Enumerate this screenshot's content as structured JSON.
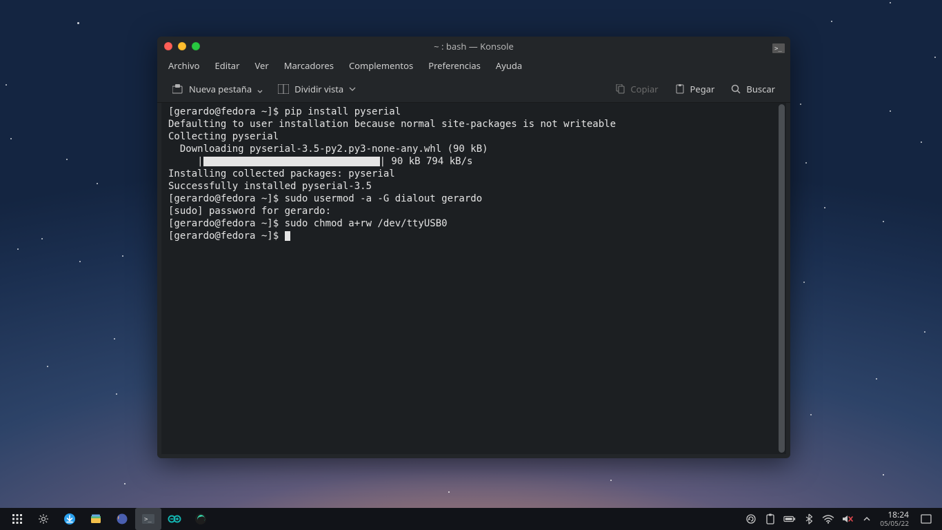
{
  "window": {
    "title": "~ : bash — Konsole",
    "menu": [
      "Archivo",
      "Editar",
      "Ver",
      "Marcadores",
      "Complementos",
      "Preferencias",
      "Ayuda"
    ],
    "toolbar": {
      "new_tab": "Nueva pestaña",
      "split_view": "Dividir vista",
      "copy": "Copiar",
      "paste": "Pegar",
      "search": "Buscar"
    }
  },
  "terminal": {
    "lines": [
      "[gerardo@fedora ~]$ pip install pyserial",
      "Defaulting to user installation because normal site-packages is not writeable",
      "Collecting pyserial",
      "  Downloading pyserial-3.5-py2.py3-none-any.whl (90 kB)",
      "| 90 kB 794 kB/s",
      "Installing collected packages: pyserial",
      "Successfully installed pyserial-3.5",
      "[gerardo@fedora ~]$ sudo usermod -a -G dialout gerardo",
      "[sudo] password for gerardo:",
      "[gerardo@fedora ~]$ sudo chmod a+rw /dev/ttyUSB0",
      "[gerardo@fedora ~]$ "
    ],
    "progress_prefix": "     |"
  },
  "taskbar": {
    "time": "18:24",
    "date": "05/05/22"
  }
}
